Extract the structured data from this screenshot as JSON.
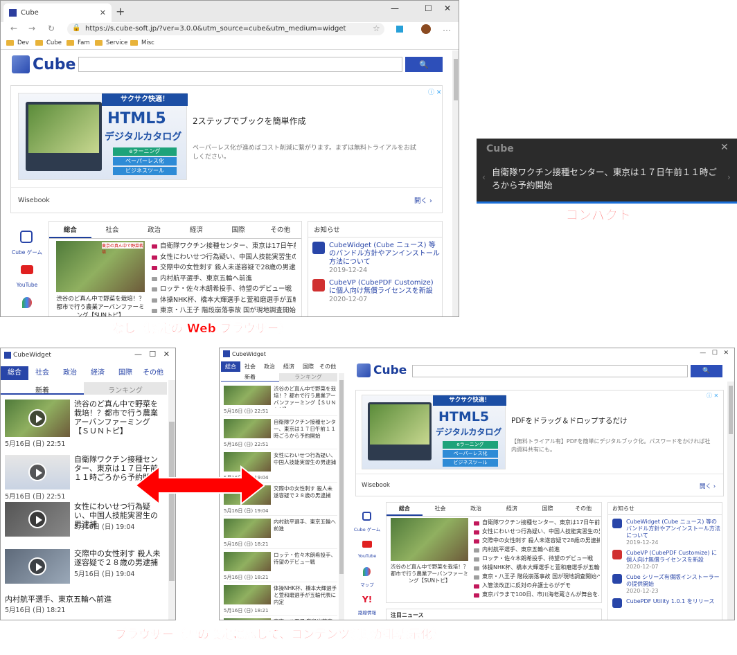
{
  "browser": {
    "tab_title": "Cube",
    "url": "https://s.cube-soft.jp/?ver=3.0.0&utm_source=cube&utm_medium=widget",
    "bookmarks": [
      "Dev",
      "Cube",
      "Fam",
      "Service",
      "Misc"
    ]
  },
  "cube": {
    "logo": "Cube",
    "search_icon": "search-icon"
  },
  "ad": {
    "banner_top": "サクサク快適！",
    "banner_main": "HTML5",
    "banner_sub": "デジタルカタログ",
    "pills": [
      "eラーニング",
      "ペーパーレス化",
      "ビジネスツール"
    ],
    "headline": "2ステップでブックを簡単作成",
    "description": "ペーパーレス化が進めばコスト削減に繋がります。まずは無料トライアルをお試しください。",
    "source": "Wisebook",
    "open": "開く",
    "headline_b": "PDFをドラッグ＆ドロップするだけ",
    "description_b": "【無料トライアル有】PDFを簡単にデジタルブック化。パスワードをかければ社内資料共有にも。"
  },
  "categories": [
    "総合",
    "社会",
    "政治",
    "経済",
    "国際",
    "その他"
  ],
  "side_icons": [
    {
      "label": "Cube ゲーム",
      "icon": "cube-game-icon"
    },
    {
      "label": "YouTube",
      "icon": "youtube-icon"
    },
    {
      "label": "マップ",
      "icon": "maps-icon"
    },
    {
      "label": "路線情報",
      "icon": "yahoo-icon"
    }
  ],
  "feature": {
    "caption": "渋谷のど真ん中で野菜を栽培！？都市で行う農業アーバンファーミング【SUNトピ】",
    "thumb_caption": "東京の真ん中で野菜栽培"
  },
  "news": [
    "自衛隊ワクチン接種センター、東京は17日午前11時ごろ…",
    "女性にわいせつ行為疑い、中国人技能実習生の男逮捕",
    "交際中の女性刺す 殺人未遂容疑で28歳の男逮捕",
    "内村航平選手、東京五輪へ前進",
    "ロッテ・佐々木朗希投手、待望のデビュー戦",
    "体操NHK杯、橋本大輝選手と萱和磨選手が五輪代表に",
    "東京・八王子 階段崩落事故 国が現地調査開始へ",
    "入管法改正に反対の弁護士らがデモ",
    "東京パラまで100日、市川海老蔵さんが舞台を…"
  ],
  "notices": {
    "title": "お知らせ",
    "items": [
      {
        "text": "CubeWidget (Cube ニュース) 等のバンドル方針やアンインストール方法について",
        "date": "2019-12-24"
      },
      {
        "text": "CubeVP (CubePDF Customize) に個人向け無償ライセンスを新設",
        "date": "2020-12-07"
      },
      {
        "text": "Cube シリーズ有償版インストーラーの提供開始",
        "date": "2020-12-23"
      },
      {
        "text": "CubePDF Utility 1.0.1 をリリース",
        "date": ""
      }
    ]
  },
  "compact": {
    "title": "Cube",
    "text": "自衛隊ワクチン接種センター、東京は１７日午前１１時ごろから予約開始"
  },
  "widget": {
    "title": "CubeWidget",
    "tabs": [
      "新着",
      "ランキング"
    ],
    "items": [
      {
        "title": "渋谷のど真ん中で野菜を栽培！？都市で行う農業アーバンファーミング【ＳＵＮトピ】",
        "date": "5月16日 (日) 22:51"
      },
      {
        "title": "自衛隊ワクチン接種センター、東京は１７日午前１１時ごろから予約開始",
        "date": "5月16日 (日) 22:51"
      },
      {
        "title": "女性にわいせつ行為疑い、中国人技能実習生の男逮捕",
        "date": "5月16日 (日) 19:04"
      },
      {
        "title": "交際中の女性刺す 殺人未遂容疑で２８歳の男逮捕",
        "date": "5月16日 (日) 19:04"
      },
      {
        "title": "内村航平選手、東京五輪へ前進",
        "date": "5月16日 (日) 18:21"
      }
    ],
    "mini_items": [
      {
        "title": "渋谷のど真ん中で野菜を栽培！？都市で行う農業アーバンファーミング【ＳＵＮトピ】",
        "date": "5月16日 (日) 22:51"
      },
      {
        "title": "自衛隊ワクチン接種センター、東京は１７日午前１１時ごろから予約開始",
        "date": "5月16日 (日) 22:51"
      },
      {
        "title": "女性にわいせつ行為疑い、中国人技能実習生の男逮捕",
        "date": "5月16日 (日) 19:04"
      },
      {
        "title": "交際中の女性刺す 殺人未遂容疑で２８歳の男逮捕",
        "date": "5月16日 (日) 19:04"
      },
      {
        "title": "内村航平選手、東京五輪へ前進",
        "date": "5月16日 (日) 18:21"
      },
      {
        "title": "ロッテ・佐々木朗希投手、待望のデビュー戦",
        "date": "5月16日 (日) 18:21"
      },
      {
        "title": "体操NHK杯、橋本大輝選手と萱和磨選手が五輪代表に内定",
        "date": "5月16日 (日) 18:21"
      },
      {
        "title": "東京・八王子 階段崩落事故 国が現地調査開始へ",
        "date": ""
      }
    ],
    "latest_news": "注目ニュース"
  },
  "labels": {
    "none": "なし（既定の Web ブラウザー）",
    "compact": "コンパクト",
    "browser": "ブラウザー（幅の設定に応じて、コンテンツ領域が非表示化）"
  }
}
